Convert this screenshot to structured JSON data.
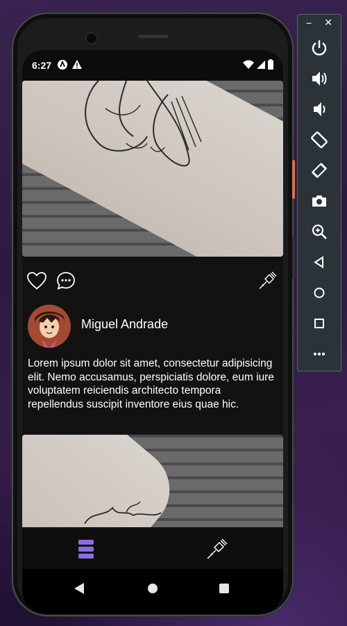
{
  "status_bar": {
    "time": "6:27",
    "left_icons": [
      "app-icon",
      "warning-icon"
    ],
    "right_icons": [
      "wifi-icon",
      "signal-icon",
      "battery-icon"
    ]
  },
  "post": {
    "author_name": "Miguel Andrade",
    "caption": "Lorem ipsum dolor sit amet, consectetur adipisicing elit. Nemo accusamus, perspiciatis dolore, eum iure voluptatem reiciendis architecto tempora repellendus suscipit inventore eius quae hic.",
    "actions": [
      "heart-icon",
      "comment-icon",
      "tattoo-machine-icon"
    ]
  },
  "bottom_nav": {
    "items": [
      "feed-icon",
      "tattoo-machine-icon"
    ],
    "active_color": "#8a6de0"
  },
  "system_nav": [
    "back-button",
    "home-button",
    "recents-button"
  ],
  "emulator_toolbar": {
    "minimize": "−",
    "close": "✕",
    "buttons": [
      "power-icon",
      "volume-up-icon",
      "volume-down-icon",
      "rotate-left-icon",
      "rotate-right-icon",
      "camera-icon",
      "zoom-icon",
      "back-icon",
      "home-icon",
      "overview-icon",
      "more-icon"
    ]
  }
}
